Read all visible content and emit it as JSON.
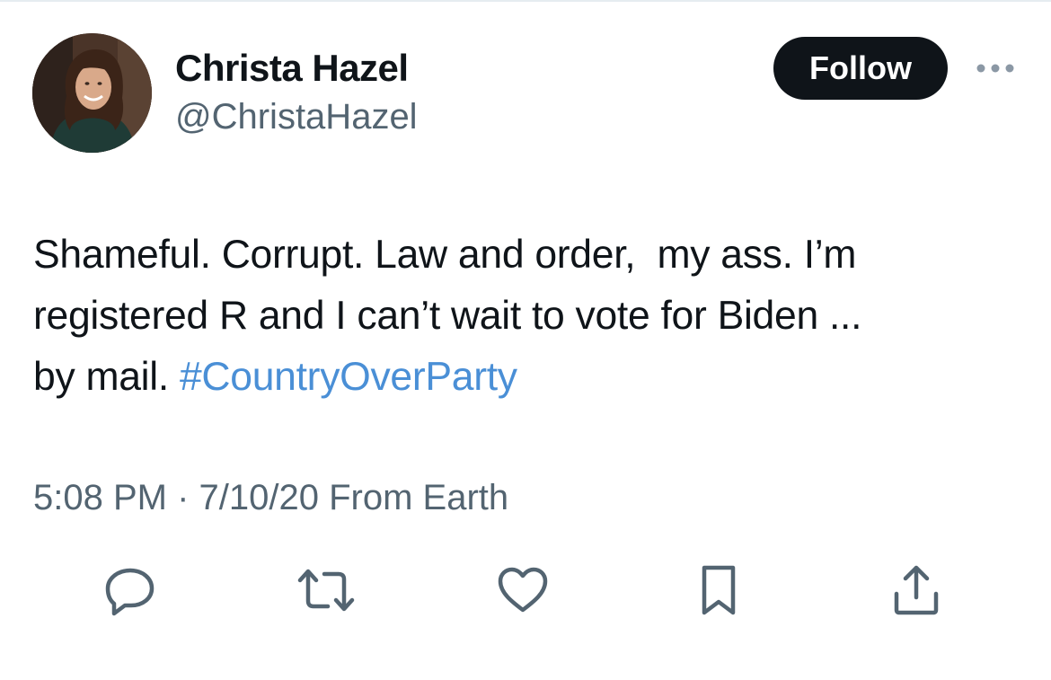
{
  "author": {
    "display_name": "Christa Hazel",
    "handle": "@ChristaHazel",
    "avatar_icon": "profile-photo"
  },
  "header": {
    "follow_label": "Follow",
    "more_icon": "more-horizontal-icon"
  },
  "tweet": {
    "text_line1": "Shameful. Corrupt. Law and order,  my ass. I’m",
    "text_line2": "registered R and I can’t wait to vote for Biden ...",
    "text_line3_prefix": "by mail. ",
    "hashtag": "#CountryOverParty"
  },
  "meta": {
    "time": "5:08 PM",
    "separator": " · ",
    "date": "7/10/20",
    "source": " From Earth"
  },
  "actions": {
    "icons": [
      "reply-icon",
      "retweet-icon",
      "like-icon",
      "bookmark-icon",
      "share-icon"
    ]
  },
  "colors": {
    "hashtag": "#4a8fd6",
    "secondary_text": "#536471",
    "primary_text": "#0f1419",
    "follow_button_bg": "#0f1419"
  }
}
